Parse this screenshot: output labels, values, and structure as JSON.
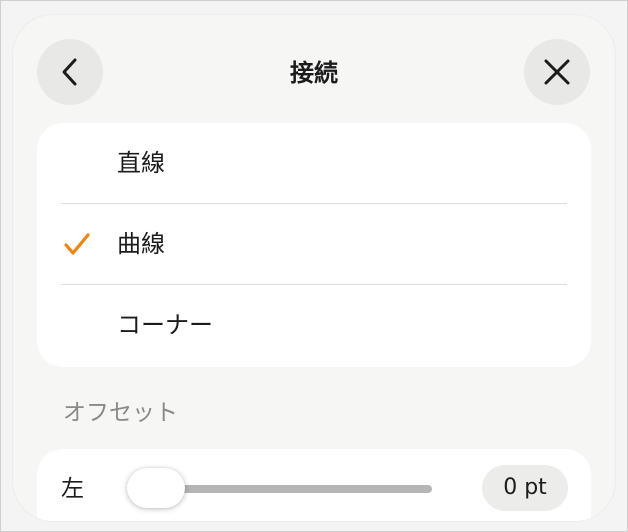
{
  "header": {
    "title": "接続",
    "back_icon": "chevron-left-icon",
    "close_icon": "close-icon"
  },
  "connection_options": [
    {
      "label": "直線",
      "selected": false
    },
    {
      "label": "曲線",
      "selected": true
    },
    {
      "label": "コーナー",
      "selected": false
    }
  ],
  "offset_section": {
    "title": "オフセット",
    "slider": {
      "label": "左",
      "value": 0,
      "value_text": "0 pt"
    }
  },
  "colors": {
    "accent": "#F0850E",
    "background": "#F6F6F5",
    "card": "#FFFFFF",
    "button": "#E8E8E7"
  }
}
